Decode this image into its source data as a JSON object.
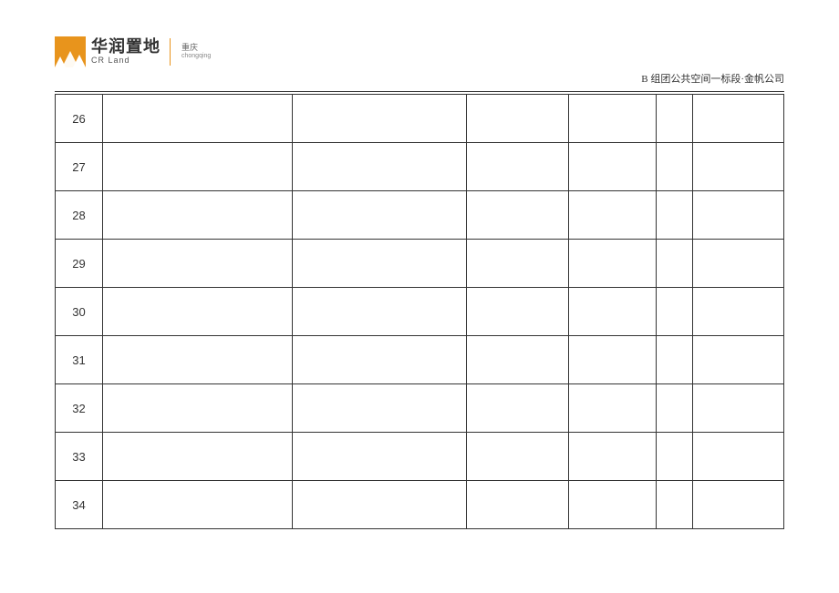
{
  "header": {
    "logo": {
      "cn_name": "华润置地",
      "en_name": "CR Land",
      "region_cn": "重庆",
      "region_en": "chongqing"
    },
    "doc_label": "B 组团公共空间一标段·金帆公司"
  },
  "table": {
    "rows": [
      {
        "num": "26",
        "c2": "",
        "c3": "",
        "c4": "",
        "c5": "",
        "c6": "",
        "c7": ""
      },
      {
        "num": "27",
        "c2": "",
        "c3": "",
        "c4": "",
        "c5": "",
        "c6": "",
        "c7": ""
      },
      {
        "num": "28",
        "c2": "",
        "c3": "",
        "c4": "",
        "c5": "",
        "c6": "",
        "c7": ""
      },
      {
        "num": "29",
        "c2": "",
        "c3": "",
        "c4": "",
        "c5": "",
        "c6": "",
        "c7": ""
      },
      {
        "num": "30",
        "c2": "",
        "c3": "",
        "c4": "",
        "c5": "",
        "c6": "",
        "c7": ""
      },
      {
        "num": "31",
        "c2": "",
        "c3": "",
        "c4": "",
        "c5": "",
        "c6": "",
        "c7": ""
      },
      {
        "num": "32",
        "c2": "",
        "c3": "",
        "c4": "",
        "c5": "",
        "c6": "",
        "c7": ""
      },
      {
        "num": "33",
        "c2": "",
        "c3": "",
        "c4": "",
        "c5": "",
        "c6": "",
        "c7": ""
      },
      {
        "num": "34",
        "c2": "",
        "c3": "",
        "c4": "",
        "c5": "",
        "c6": "",
        "c7": ""
      }
    ]
  }
}
